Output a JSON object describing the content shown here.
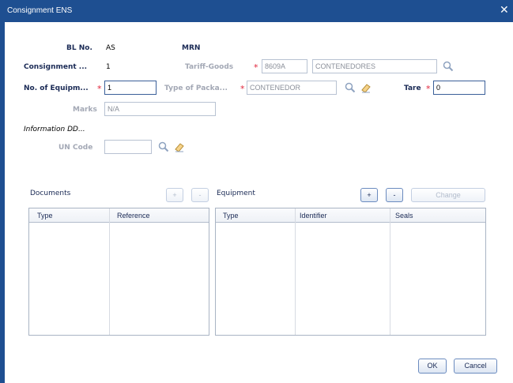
{
  "window": {
    "title": "Consignment ENS"
  },
  "form": {
    "bl_no": {
      "label": "BL No.",
      "value": "AS"
    },
    "mrn": {
      "label": "MRN"
    },
    "consignment": {
      "label": "Consignment ...",
      "value": "1"
    },
    "tariff_goods": {
      "label": "Tariff-Goods",
      "code": "8609A",
      "description": "CONTENEDORES"
    },
    "no_of_equipment": {
      "label": "No. of Equipm...",
      "value": "1"
    },
    "type_of_package": {
      "label": "Type of Packa...",
      "value": "CONTENEDOR"
    },
    "tare": {
      "label": "Tare",
      "value": "0"
    },
    "marks": {
      "label": "Marks",
      "value": "N/A"
    },
    "information_dd": {
      "label": "Information DD..."
    },
    "un_code": {
      "label": "UN Code",
      "value": ""
    },
    "required_marker": "*"
  },
  "documents": {
    "title": "Documents",
    "add_label": "+",
    "remove_label": "-",
    "columns": [
      "Type",
      "Reference"
    ]
  },
  "equipment": {
    "title": "Equipment",
    "add_label": "+",
    "remove_label": "-",
    "change_label": "Change",
    "columns": [
      "Type",
      "Identifier",
      "Seals"
    ]
  },
  "footer": {
    "ok_label": "OK",
    "cancel_label": "Cancel"
  },
  "colors": {
    "title_bar": "#1e4f91",
    "required": "#e0243a",
    "label": "#1a2a55"
  },
  "icons": {
    "search": "search-icon",
    "eraser": "eraser-icon",
    "close": "close-icon"
  }
}
